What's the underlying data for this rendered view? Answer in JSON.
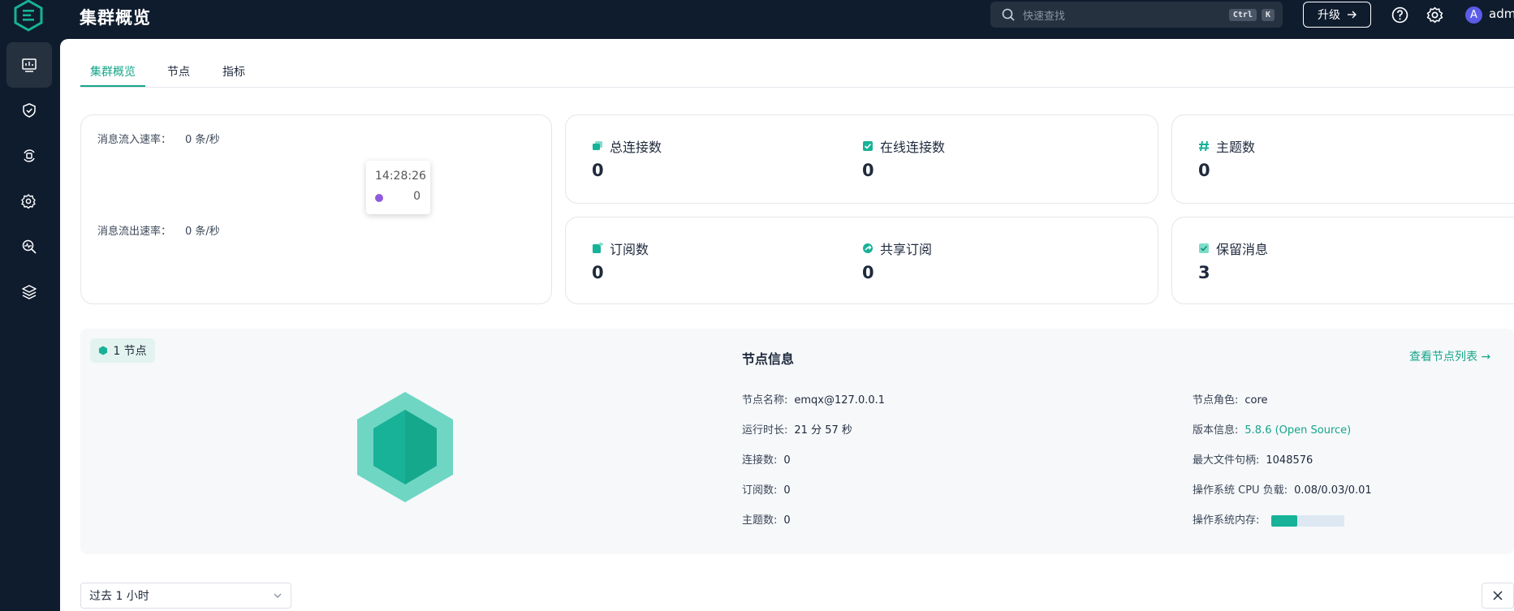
{
  "header": {
    "title": "集群概览",
    "search_placeholder": "快速查找",
    "shortcut_ctrl": "Ctrl",
    "shortcut_key": "K",
    "upgrade_label": "升级",
    "avatar_letter": "A",
    "username": "admi"
  },
  "sidebar": {
    "items": [
      {
        "icon": "dashboard-icon",
        "active": true
      },
      {
        "icon": "shield-icon",
        "active": false
      },
      {
        "icon": "integration-icon",
        "active": false
      },
      {
        "icon": "management-icon",
        "active": false
      },
      {
        "icon": "diagnose-icon",
        "active": false
      },
      {
        "icon": "layers-icon",
        "active": false
      }
    ]
  },
  "tabs": [
    {
      "label": "集群概览",
      "active": true
    },
    {
      "label": "节点",
      "active": false
    },
    {
      "label": "指标",
      "active": false
    }
  ],
  "rates": {
    "in_label": "消息流入速率：",
    "in_value": "0 条/秒",
    "out_label": "消息流出速率：",
    "out_value": "0 条/秒",
    "tooltip_time": "14:28:26",
    "tooltip_value": "0"
  },
  "stats": {
    "total_connections": {
      "label": "总连接数",
      "value": "0"
    },
    "live_connections": {
      "label": "在线连接数",
      "value": "0"
    },
    "topics": {
      "label": "主题数",
      "value": "0"
    },
    "subscriptions": {
      "label": "订阅数",
      "value": "0"
    },
    "shared_subscriptions": {
      "label": "共享订阅",
      "value": "0"
    },
    "retained": {
      "label": "保留消息",
      "value": "3"
    }
  },
  "node": {
    "badge": "1 节点",
    "info_title": "节点信息",
    "list_link": "查看节点列表",
    "left": [
      {
        "k": "节点名称:",
        "v": "emqx@127.0.0.1"
      },
      {
        "k": "运行时长:",
        "v": "21 分 57 秒"
      },
      {
        "k": "连接数:",
        "v": "0"
      },
      {
        "k": "订阅数:",
        "v": "0"
      },
      {
        "k": "主题数:",
        "v": "0"
      }
    ],
    "right": [
      {
        "k": "节点角色:",
        "v": "core"
      },
      {
        "k": "版本信息:",
        "v": "5.8.6 (Open Source)"
      },
      {
        "k": "最大文件句柄:",
        "v": "1048576"
      },
      {
        "k": "操作系统 CPU 负载:",
        "v": "0.08/0.03/0.01"
      },
      {
        "k": "操作系统内存:",
        "v": ""
      }
    ],
    "memory_usage_fraction": 0.36
  },
  "time_range": {
    "selected": "过去 1 小时"
  },
  "colors": {
    "accent": "#17a58a",
    "navy": "#0f1c2e"
  }
}
